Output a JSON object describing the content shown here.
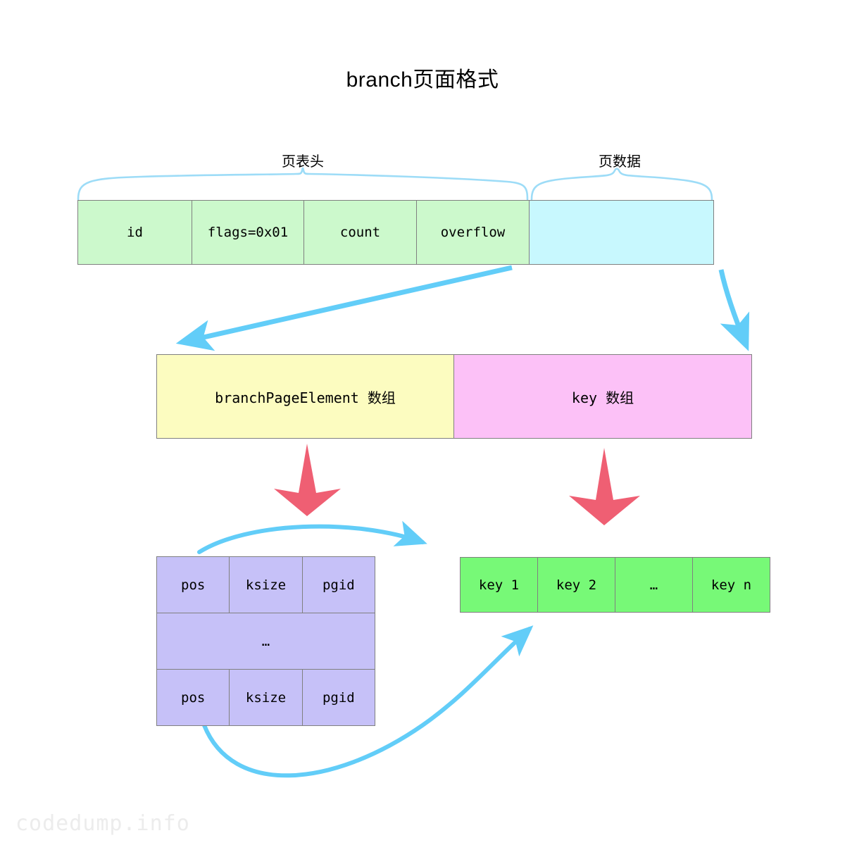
{
  "title": "branch页面格式",
  "colors": {
    "header_green": "#ccf9cc",
    "data_cyan": "#c8f8fe",
    "element_yellow": "#fcfcc0",
    "key_pink": "#fcc1f7",
    "element_purple": "#c6c1f8",
    "key_green": "#77f977",
    "arrow_blue": "#62cdf8",
    "arrow_red": "#ef5f73",
    "border_gray": "#808080"
  },
  "braces": {
    "header_label": "页表头",
    "data_label": "页数据"
  },
  "page_header_row": {
    "cells": [
      {
        "label": "id"
      },
      {
        "label": "flags=0x01"
      },
      {
        "label": "count"
      },
      {
        "label": "overflow"
      },
      {
        "label": ""
      }
    ]
  },
  "arrays_row": {
    "cells": [
      {
        "label": "branchPageElement 数组"
      },
      {
        "label": "key 数组"
      }
    ]
  },
  "element_table": {
    "rows": [
      {
        "cells": [
          "pos",
          "ksize",
          "pgid"
        ]
      },
      {
        "cells": [
          "…"
        ]
      },
      {
        "cells": [
          "pos",
          "ksize",
          "pgid"
        ]
      }
    ]
  },
  "key_array": {
    "cells": [
      "key 1",
      "key 2",
      "…",
      "key n"
    ]
  },
  "watermark": "codedump.info"
}
